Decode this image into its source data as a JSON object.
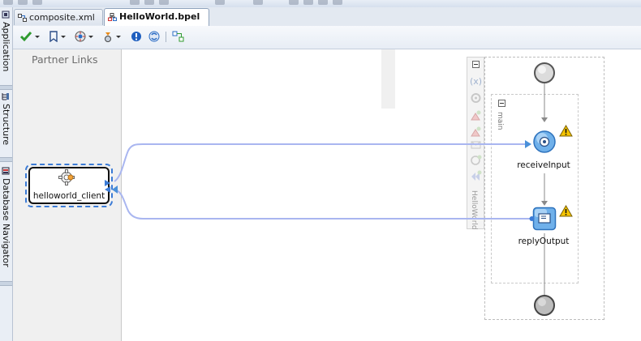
{
  "tabs": [
    {
      "label": "composite.xml",
      "active": false
    },
    {
      "label": "HelloWorld.bpel",
      "active": true
    }
  ],
  "side_tabs": [
    {
      "label": "Application"
    },
    {
      "label": "Structure"
    },
    {
      "label": "Database Navigator"
    }
  ],
  "partner_panel": {
    "title": "Partner Links",
    "partner_link": {
      "label": "helloworld_client"
    }
  },
  "process": {
    "name": "HelloWorld",
    "scope": {
      "label": "main"
    },
    "activities": [
      {
        "label": "receiveInput",
        "type": "receive",
        "warning": true
      },
      {
        "label": "replyOutput",
        "type": "reply",
        "warning": true
      }
    ]
  },
  "colors": {
    "accent": "#3b7bd6",
    "connector": "#a9b6f0",
    "warning": "#f5c400"
  }
}
